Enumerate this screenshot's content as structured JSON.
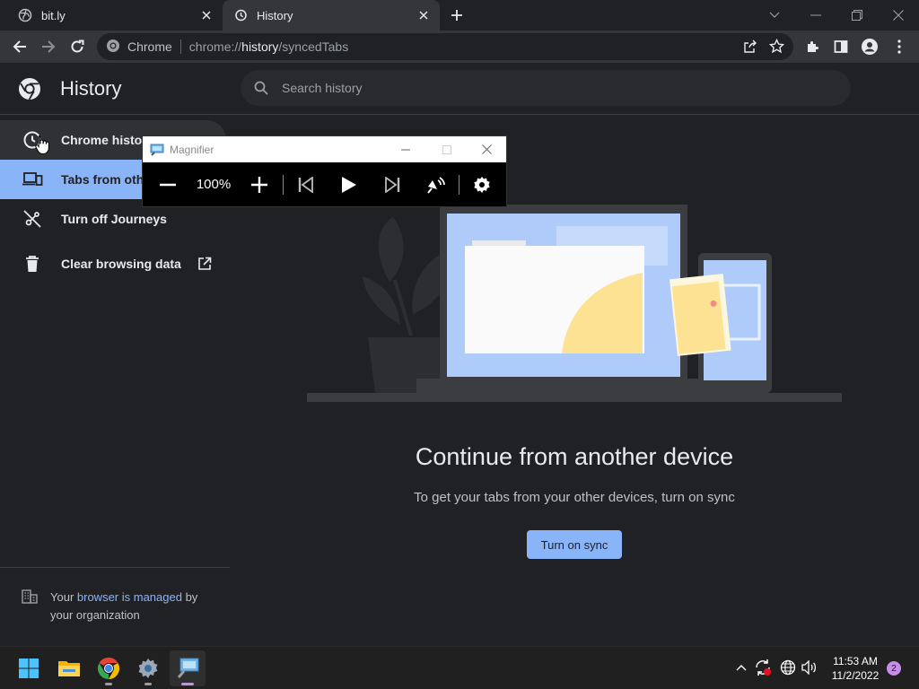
{
  "browser": {
    "tabs": [
      {
        "title": "bit.ly",
        "active": false
      },
      {
        "title": "History",
        "active": true
      }
    ],
    "omnibox": {
      "site_chip": "Chrome",
      "url_prefix": "chrome://",
      "url_host": "history",
      "url_path": "/syncedTabs"
    }
  },
  "header": {
    "title": "History",
    "search_placeholder": "Search history"
  },
  "sidebar": {
    "items": [
      {
        "label": "Chrome history",
        "icon": "clock-icon",
        "state": "hover"
      },
      {
        "label": "Tabs from other devices",
        "icon": "devices-icon",
        "state": "selected"
      },
      {
        "label": "Turn off Journeys",
        "icon": "journeys-off-icon",
        "state": "normal"
      },
      {
        "label": "Clear browsing data",
        "icon": "trash-icon",
        "state": "normal"
      }
    ],
    "managed": {
      "prefix": "Your ",
      "link": "browser is managed",
      "suffix": " by your organization"
    }
  },
  "main": {
    "heading": "Continue from another device",
    "subtext": "To get your tabs from your other devices, turn on sync",
    "sync_button": "Turn on sync"
  },
  "magnifier": {
    "title": "Magnifier",
    "zoom": "100%"
  },
  "taskbar": {
    "apps": [
      "start-icon",
      "file-explorer-icon",
      "chrome-icon",
      "settings-icon",
      "magnifier-icon"
    ],
    "time": "11:53 AM",
    "date": "11/2/2022",
    "notification_count": "2"
  },
  "colors": {
    "accent": "#8ab4f8",
    "background": "#202124",
    "toolbar": "#35363a",
    "taskbar_accent": "#c68ee6"
  }
}
